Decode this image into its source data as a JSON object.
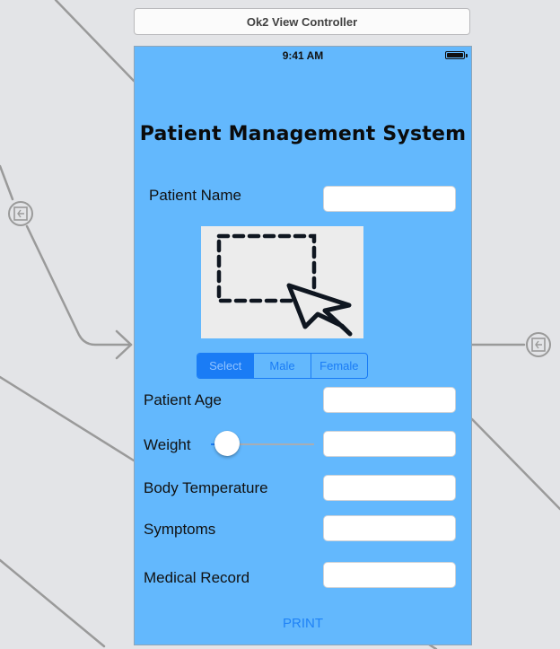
{
  "scene": {
    "title": "Ok2 View Controller"
  },
  "status_bar": {
    "time": "9:41 AM",
    "battery_icon": "battery-full-icon"
  },
  "app": {
    "title": "Patient Management System"
  },
  "form": {
    "patient_name_label": "Patient Name",
    "patient_name_value": "",
    "gender_options": [
      "Select",
      "Male",
      "Female"
    ],
    "gender_selected": "Select",
    "patient_age_label": "Patient Age",
    "patient_age_value": "",
    "weight_label": "Weight",
    "weight_value": "",
    "weight_slider_level": 0.0,
    "body_temperature_label": "Body Temperature",
    "body_temperature_value": "",
    "symptoms_label": "Symptoms",
    "symptoms_value": "",
    "medical_record_label": "Medical Record",
    "medical_record_value": "",
    "image_icon": "selection-cursor-icon"
  },
  "actions": {
    "print_label": "PRINT"
  },
  "colors": {
    "device_background": "#63b8fd",
    "tint": "#1a7cf5",
    "canvas": "#e3e4e7"
  }
}
